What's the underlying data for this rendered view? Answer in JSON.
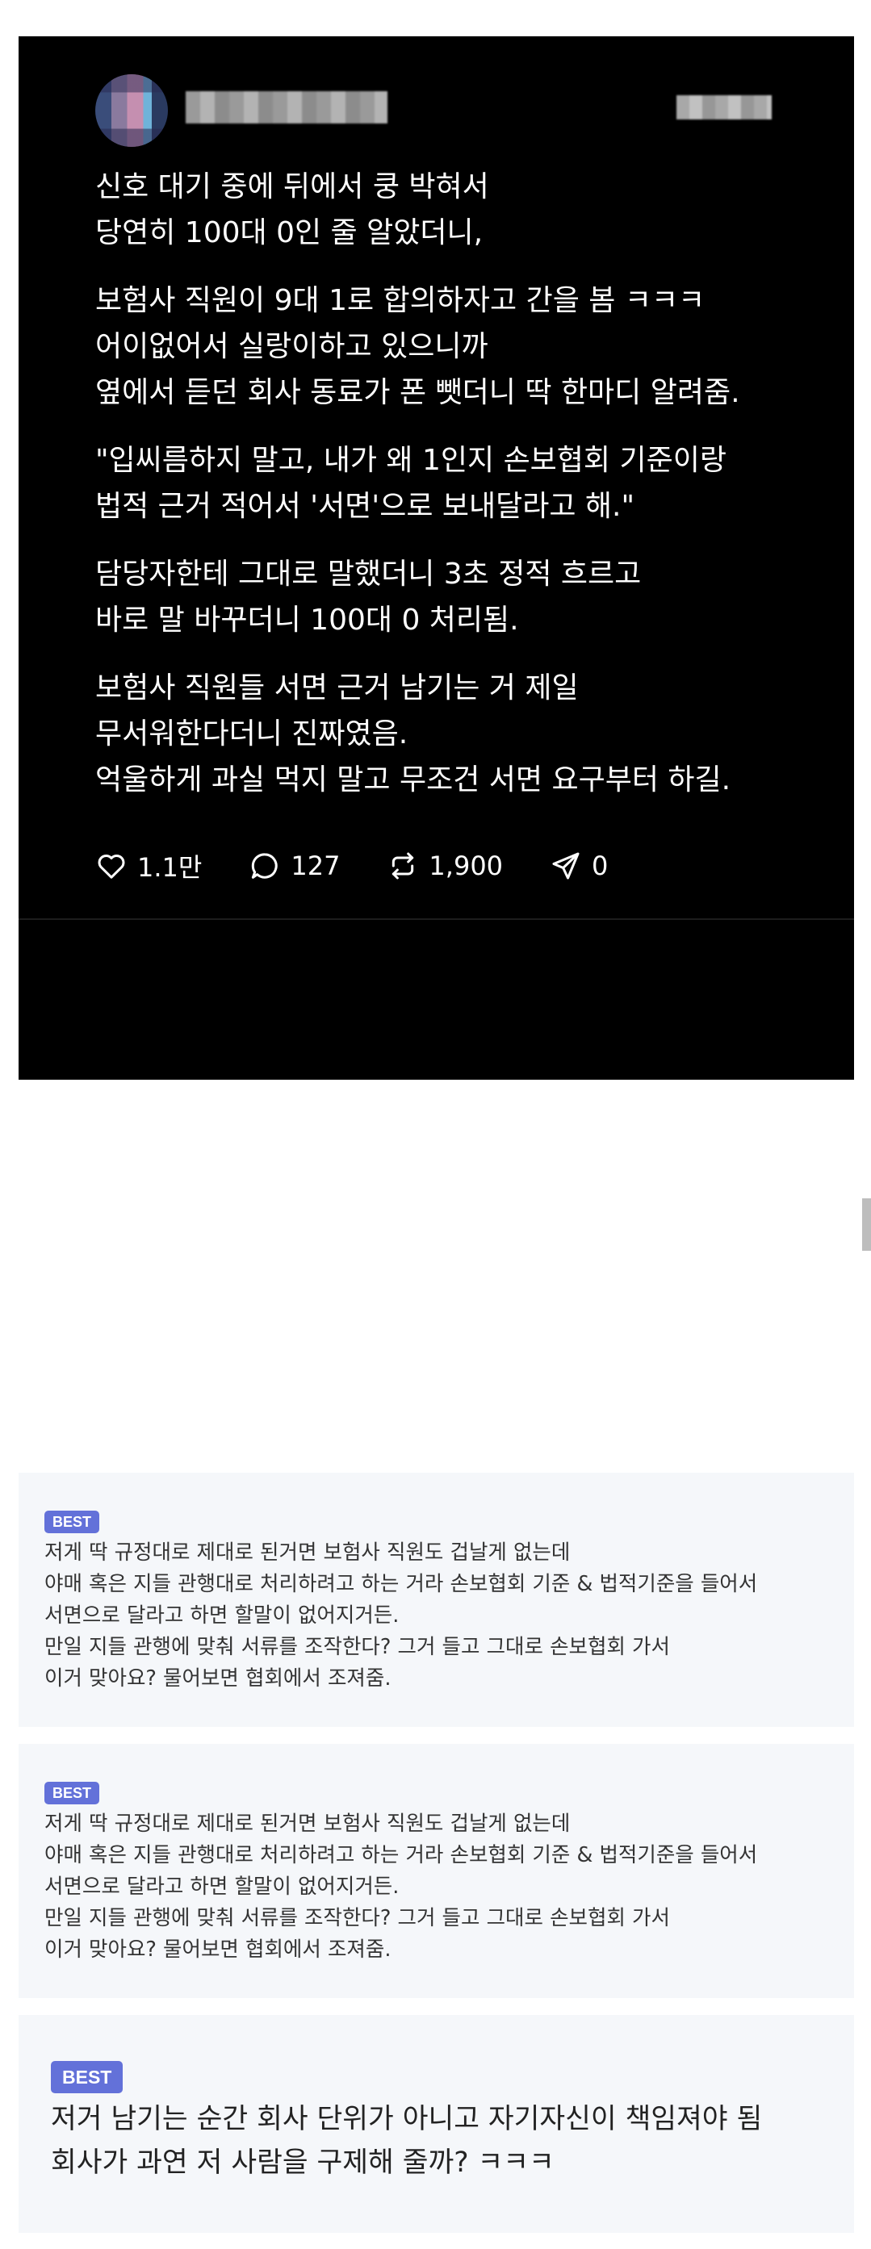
{
  "post": {
    "paragraphs": [
      "신호 대기 중에 뒤에서 쿵 박혀서\n당연히 100대 0인 줄 알았더니,",
      "보험사 직원이 9대 1로 합의하자고 간을 봄 ㅋㅋㅋ\n어이없어서 실랑이하고 있으니까\n옆에서 듣던 회사 동료가 폰 뺏더니 딱 한마디 알려줌.",
      "\"입씨름하지 말고, 내가 왜 1인지 손보협회 기준이랑\n법적 근거 적어서 '서면'으로 보내달라고 해.\"",
      "담당자한테 그대로 말했더니 3초 정적 흐르고\n바로 말 바꾸더니 100대 0 처리됨.",
      "보험사 직원들 서면 근거 남기는 거 제일\n무서워한다더니 진짜였음.\n억울하게 과실 먹지 말고 무조건 서면 요구부터 하길."
    ],
    "actions": {
      "likes": "1.1만",
      "comments": "127",
      "reposts": "1,900",
      "shares": "0"
    }
  },
  "comments": [
    {
      "badge": "BEST",
      "text": "저게 딱 규정대로 제대로 된거면 보험사 직원도 겁날게 없는데\n야매 혹은 지들 관행대로 처리하려고 하는 거라 손보협회 기준 & 법적기준을 들어서\n서면으로 달라고 하면 할말이 없어지거든.\n만일 지들 관행에 맞춰 서류를 조작한다? 그거 들고 그대로 손보협회 가서\n이거 맞아요? 물어보면 협회에서 조져줌."
    },
    {
      "badge": "BEST",
      "text": "저게 딱 규정대로 제대로 된거면 보험사 직원도 겁날게 없는데\n야매 혹은 지들 관행대로 처리하려고 하는 거라 손보협회 기준 & 법적기준을 들어서\n서면으로 달라고 하면 할말이 없어지거든.\n만일 지들 관행에 맞춰 서류를 조작한다? 그거 들고 그대로 손보협회 가서\n이거 맞아요? 물어보면 협회에서 조져줌."
    },
    {
      "badge": "BEST",
      "text": "저거 남기는 순간 회사 단위가 아니고 자기자신이 책임져야 됨\n회사가 과연 저 사람을 구제해 줄까? ㅋㅋㅋ"
    }
  ],
  "colors": {
    "post_background": "#000000",
    "badge": "#6371d9",
    "comment_background": "#f5f7fa"
  },
  "icons": [
    "heart-icon",
    "comment-icon",
    "repost-icon",
    "share-icon"
  ]
}
